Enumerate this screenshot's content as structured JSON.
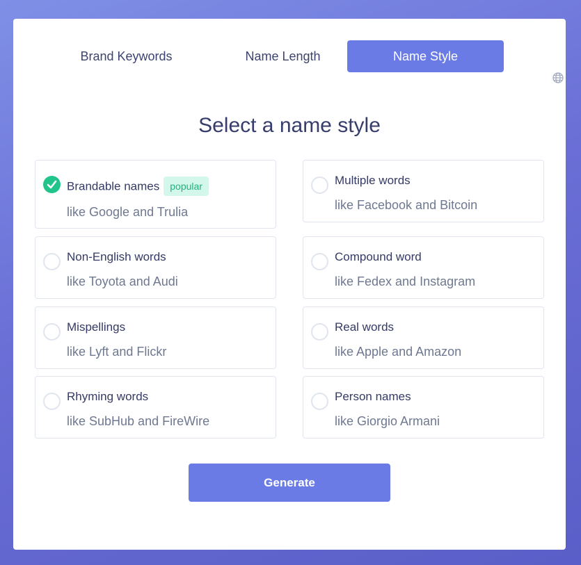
{
  "tabs": [
    {
      "label": "Brand Keywords",
      "active": false
    },
    {
      "label": "Name Length",
      "active": false
    },
    {
      "label": "Name Style",
      "active": true
    }
  ],
  "language_icon": "globe-icon",
  "heading": "Select a name style",
  "options": [
    {
      "title": "Brandable names",
      "subtitle": "like Google and Trulia",
      "selected": true,
      "badge": "popular"
    },
    {
      "title": "Multiple words",
      "subtitle": "like Facebook and Bitcoin",
      "selected": false
    },
    {
      "title": "Non-English words",
      "subtitle": "like Toyota and Audi",
      "selected": false
    },
    {
      "title": "Compound word",
      "subtitle": "like Fedex and Instagram",
      "selected": false
    },
    {
      "title": "Mispellings",
      "subtitle": "like Lyft and Flickr",
      "selected": false
    },
    {
      "title": "Real words",
      "subtitle": "like Apple and Amazon",
      "selected": false
    },
    {
      "title": "Rhyming words",
      "subtitle": "like SubHub and FireWire",
      "selected": false
    },
    {
      "title": "Person names",
      "subtitle": "like Giorgio Armani",
      "selected": false
    }
  ],
  "generate_label": "Generate",
  "colors": {
    "accent": "#6a7be6",
    "selected": "#21c48a",
    "badge_bg": "#d3f7ea",
    "badge_text": "#21b37f"
  }
}
